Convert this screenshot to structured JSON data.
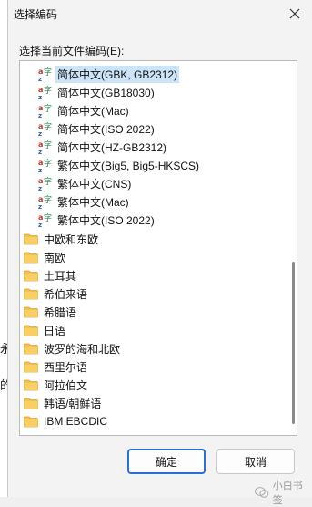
{
  "dialog": {
    "title": "选择编码",
    "list_label": "选择当前文件编码(E):",
    "ok_label": "确定",
    "cancel_label": "取消"
  },
  "encodings": [
    {
      "label": "简体中文(GBK, GB2312)",
      "selected": true
    },
    {
      "label": "简体中文(GB18030)"
    },
    {
      "label": "简体中文(Mac)"
    },
    {
      "label": "简体中文(ISO 2022)"
    },
    {
      "label": "简体中文(HZ-GB2312)"
    },
    {
      "label": "繁体中文(Big5, Big5-HKSCS)"
    },
    {
      "label": "繁体中文(CNS)"
    },
    {
      "label": "繁体中文(Mac)"
    },
    {
      "label": "繁体中文(ISO 2022)"
    }
  ],
  "groups": [
    {
      "label": "中欧和东欧"
    },
    {
      "label": "南欧"
    },
    {
      "label": "土耳其"
    },
    {
      "label": "希伯来语"
    },
    {
      "label": "希腊语"
    },
    {
      "label": "日语"
    },
    {
      "label": "波罗的海和北欧"
    },
    {
      "label": "西里尔语"
    },
    {
      "label": "阿拉伯文"
    },
    {
      "label": "韩语/朝鲜语"
    },
    {
      "label": "IBM EBCDIC"
    }
  ],
  "background": {
    "char1": "永",
    "char2": "的"
  },
  "watermark": {
    "text": "小白书签"
  },
  "icons": {
    "close": "close-icon",
    "encoding": "encoding-icon",
    "folder": "folder-icon"
  },
  "colors": {
    "accent": "#2a6fd6",
    "selection": "#cce4f7",
    "folder": "#f2c14e"
  }
}
